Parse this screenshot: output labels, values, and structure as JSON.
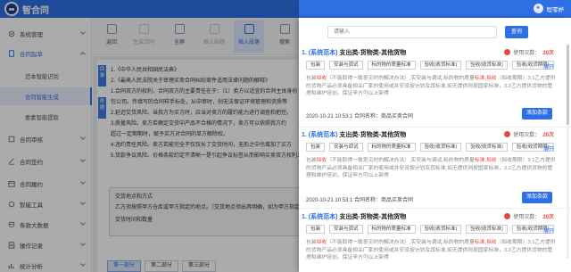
{
  "app": {
    "name": "智合同",
    "user": "程零婷",
    "accent": "#2f6fe4"
  },
  "sidebar": {
    "items": [
      {
        "label": "系统管理",
        "icon": "settings-icon"
      },
      {
        "label": "合同起草",
        "icon": "document-icon"
      },
      {
        "label": "合同审核",
        "icon": "review-icon"
      },
      {
        "label": "合同签约",
        "icon": "sign-icon"
      },
      {
        "label": "合同履约",
        "icon": "calendar-icon"
      },
      {
        "label": "智能工具",
        "icon": "tool-icon"
      },
      {
        "label": "条款大数据",
        "icon": "database-icon"
      },
      {
        "label": "操作记录",
        "icon": "record-icon"
      },
      {
        "label": "统计分析",
        "icon": "chart-icon"
      }
    ],
    "sub_items": [
      "范本智能识别",
      "合同智能生成",
      "要素智能提取"
    ]
  },
  "toolbar": [
    "返回",
    "生成合同",
    "全屏",
    "插入标题",
    "插入段落",
    "搜索"
  ],
  "doc": {
    "label1": "目录",
    "label2": "依据",
    "lines": [
      "1.《中华人民共和国民法典》",
      "2.《最高人民法院关于审理买卖合同纠纷案件适用法律问题的解释》",
      "1.合同双方的权利，合同双方的主要责任在于：（1）卖方以适宜的合同主体身份",
      "包公司。传填写的合同样手标处，从中审时，创无法保证环境管理和资质等",
      "2.延迟交货风险。当我方为买方时，应当对卖方的履约能力进行调查和把控。",
      "3.质量风险。卖方若确定交货中产品不合格的情况下，卖方可以依照我方约",
      "超过一定期期时，赋予买方对合同的单方解除权。",
      "4.违约责任风险。卖方若能完全不仅仅长了交货时间，无形之中也增加了买方",
      "5.货款争议风险。价格条款约定不清晰一是引起争议标签从而影响买卖双方权利义务"
    ],
    "box_lines": [
      "交货地点和方式",
      "乙方须按照甲方仓库或甲方指定的地点。（交货地点须出具明确，如为甲方指定地点",
      "交货时间和数量"
    ],
    "tabs": [
      "第一部分",
      "第二部分",
      "第三部分"
    ]
  },
  "drawer": {
    "search_placeholder": "请输入",
    "search_button": "查询",
    "card_prefix": "(系统范本)",
    "card_title": "支出类-货物类-其他货物",
    "usage_label": "使用次数：",
    "usage_count": "20次",
    "tags": [
      "包装",
      "安装与调试",
      "标的物的质量标准",
      "验收(收货标准)",
      "验收(收货标准)",
      "验收(收货期限)"
    ],
    "expand": "展开",
    "body_pre": "包装",
    "body_red1": "拟收",
    "body_mid1": "（不能取得一致意见时的解决办法）,实安装与调试,标的物的质量",
    "body_red2": "标准,拟收",
    "body_mid2": "（拟收期限）3.1乙方提供的货物产品必须具备相关厂家的使用或并安设按计划及其标准,如无提供则按国家标准，3.2乙方提供货物的管理和维护培训，保证甲方可以上架得",
    "meta": "2020-10-21 10:53:1 合同名称：商品买卖合同",
    "add_button": "添加条款",
    "cards": [
      {
        "num": "1."
      },
      {
        "num": "1."
      },
      {
        "num": "1."
      }
    ]
  }
}
